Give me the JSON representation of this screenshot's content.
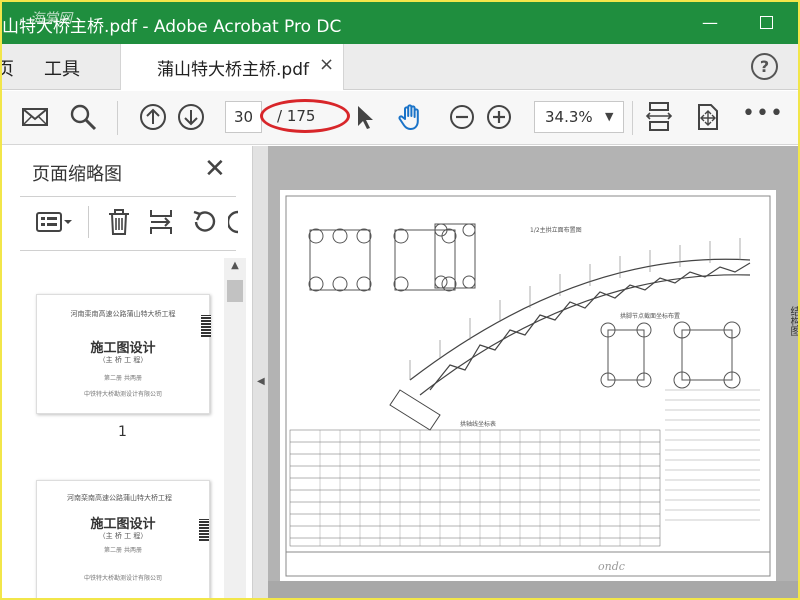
{
  "window": {
    "title": "山特大桥主桥.pdf - Adobe Acrobat Pro DC",
    "watermark": "海棠网",
    "minimize_glyph": "—"
  },
  "tabs": {
    "menu": [
      {
        "label": "页"
      },
      {
        "label": "工具"
      }
    ],
    "document_tab": {
      "label": "蒲山特大桥主桥.pdf",
      "close_glyph": "×"
    },
    "help_glyph": "?"
  },
  "toolbar": {
    "icons": [
      "email-icon",
      "search-icon",
      "page-up-icon",
      "page-down-icon",
      "select-cursor-icon",
      "hand-tool-icon",
      "zoom-out-icon",
      "zoom-in-icon",
      "fit-page-icon",
      "rotate-view-icon",
      "more-icon"
    ],
    "current_page": "30",
    "page_total": "/ 175",
    "zoom": "34.3%",
    "zoom_arrow": "▼",
    "more_glyph": "•••",
    "accent_color": "#1a73c8",
    "annotation_color": "#d8262a"
  },
  "left_panel": {
    "title": "页面缩略图",
    "close_glyph": "✕",
    "tools": [
      "thumbnail-options-icon",
      "delete-page-icon",
      "insert-page-icon",
      "undo-icon",
      "rotate-icon"
    ],
    "thumbnails": [
      {
        "header": "河南栾南高速公路蒲山特大桥工程",
        "main": "施工图设计",
        "sub": "（主 桥 工 程）",
        "volume": "第二册  共两册",
        "org": "中铁特大桥勘测设计有限公司",
        "page_label": "1"
      },
      {
        "header": "河南栾南高速公路蒲山特大桥工程",
        "main": "施工图设计",
        "sub": "（主 桥 工 程）",
        "volume": "第二册  共两册",
        "org": "中铁特大桥勘测设计有限公司"
      }
    ]
  },
  "viewer": {
    "drawing_title": "1/2主拱立面布置图",
    "table_title": "拱轴线坐标表",
    "section_title": "拱脚节点截面坐标布置",
    "footer_watermark": "ondc",
    "side_label": "结构图"
  },
  "theme": {
    "titlebar_bg": "#1f8e3e",
    "frame_border": "#f2e64a"
  }
}
